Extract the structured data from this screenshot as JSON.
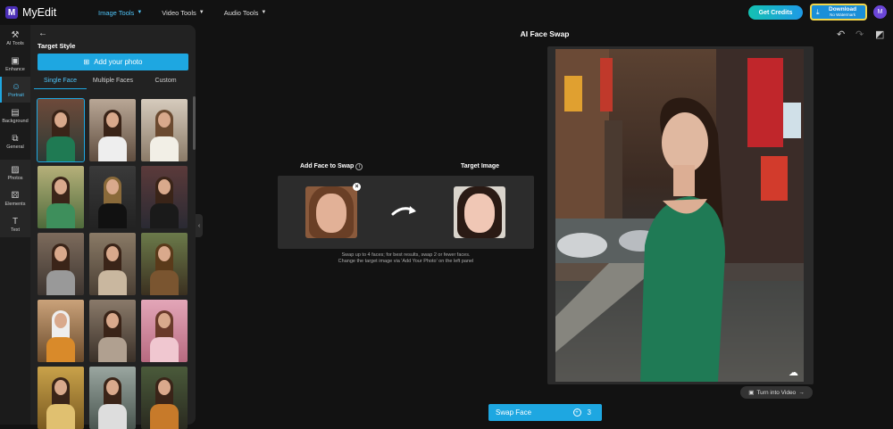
{
  "app": {
    "name": "MyEdit",
    "logo_letter": "M"
  },
  "nav": [
    {
      "label": "Image Tools",
      "active": true
    },
    {
      "label": "Video Tools",
      "active": false
    },
    {
      "label": "Audio Tools",
      "active": false
    }
  ],
  "header": {
    "credits_label": "Get Credits",
    "download_label": "Download",
    "download_sub": "No Watermark",
    "avatar_letter": "M"
  },
  "tools": [
    {
      "label": "AI Tools",
      "icon": "wand-icon"
    },
    {
      "label": "Enhance",
      "icon": "enhance-icon"
    },
    {
      "label": "Portrait",
      "icon": "portrait-icon",
      "active": true
    },
    {
      "label": "Background",
      "icon": "background-icon"
    },
    {
      "label": "General",
      "icon": "general-icon"
    },
    {
      "label": "Photos",
      "icon": "photos-icon"
    },
    {
      "label": "Elements",
      "icon": "elements-icon"
    },
    {
      "label": "Text",
      "icon": "text-icon"
    }
  ],
  "panel": {
    "title": "Target Style",
    "add_photo_label": "Add your photo",
    "tabs": [
      {
        "label": "Single Face",
        "active": true
      },
      {
        "label": "Multiple Faces",
        "active": false
      },
      {
        "label": "Custom",
        "active": false
      }
    ]
  },
  "main": {
    "title": "AI Face Swap",
    "add_face_label": "Add Face to Swap",
    "target_label": "Target Image",
    "hint_line1": "Swap up to 4 faces; for best results, swap 2 or fewer faces.",
    "hint_line2": "Change the target image via 'Add Your Photo' on the left panel",
    "turn_video_label": "Turn into Video",
    "swap_label": "Swap Face",
    "swap_cost": "3"
  },
  "colors": {
    "accent": "#1ea7e1",
    "nav_active": "#4fc3f7",
    "download_outline": "#f3d64a"
  }
}
